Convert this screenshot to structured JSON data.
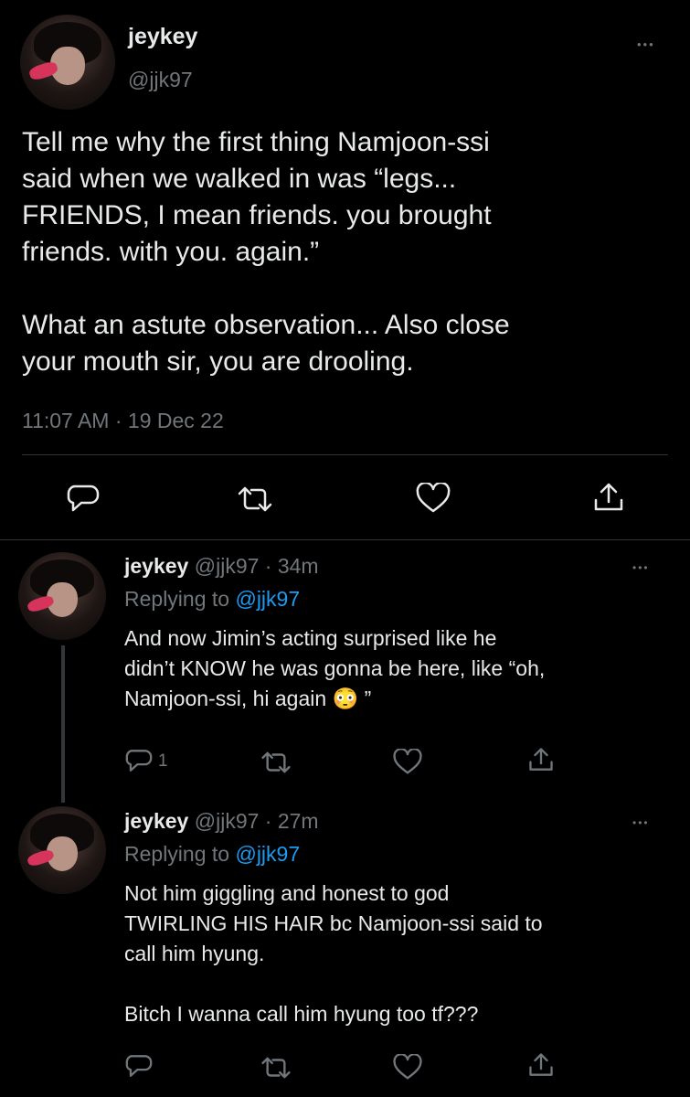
{
  "main_tweet": {
    "display_name": "jeykey",
    "handle": "@jjk97",
    "text_p1_lines": [
      "Tell me why the first thing Namjoon-ssi",
      "said when we walked in was “legs...",
      "FRIENDS, I mean friends. you brought",
      "friends. with you. again.”"
    ],
    "text_p2_lines": [
      "What an astute observation... Also close",
      "your mouth sir, you are drooling."
    ],
    "timestamp": "11:07 AM · 19 Dec 22",
    "more_label": "•••"
  },
  "replies": [
    {
      "display_name": "jeykey",
      "handle_time": "@jjk97 · 34m",
      "replying_prefix": "Replying to ",
      "replying_handle": "@jjk97",
      "lines": [
        "And now Jimin’s acting surprised like he",
        "didn’t KNOW he was gonna be here, like “oh,",
        "Namjoon-ssi, hi again 😳 ”"
      ],
      "reply_count": "1",
      "more_label": "•••"
    },
    {
      "display_name": "jeykey",
      "handle_time": "@jjk97 · 27m",
      "replying_prefix": "Replying to ",
      "replying_handle": "@jjk97",
      "lines": [
        "Not him giggling and honest to god",
        "TWIRLING HIS HAIR bc Namjoon-ssi said to",
        "call him hyung."
      ],
      "lines2": [
        "Bitch I wanna call him hyung too tf???"
      ],
      "more_label": "•••"
    }
  ],
  "icons": {
    "reply": "reply-icon",
    "retweet": "retweet-icon",
    "like": "heart-icon",
    "share": "share-icon",
    "more": "more-icon"
  },
  "colors": {
    "background": "#000000",
    "text": "#e7e9ea",
    "muted": "#71767b",
    "link": "#1d9bf0",
    "divider": "#2f3336"
  }
}
